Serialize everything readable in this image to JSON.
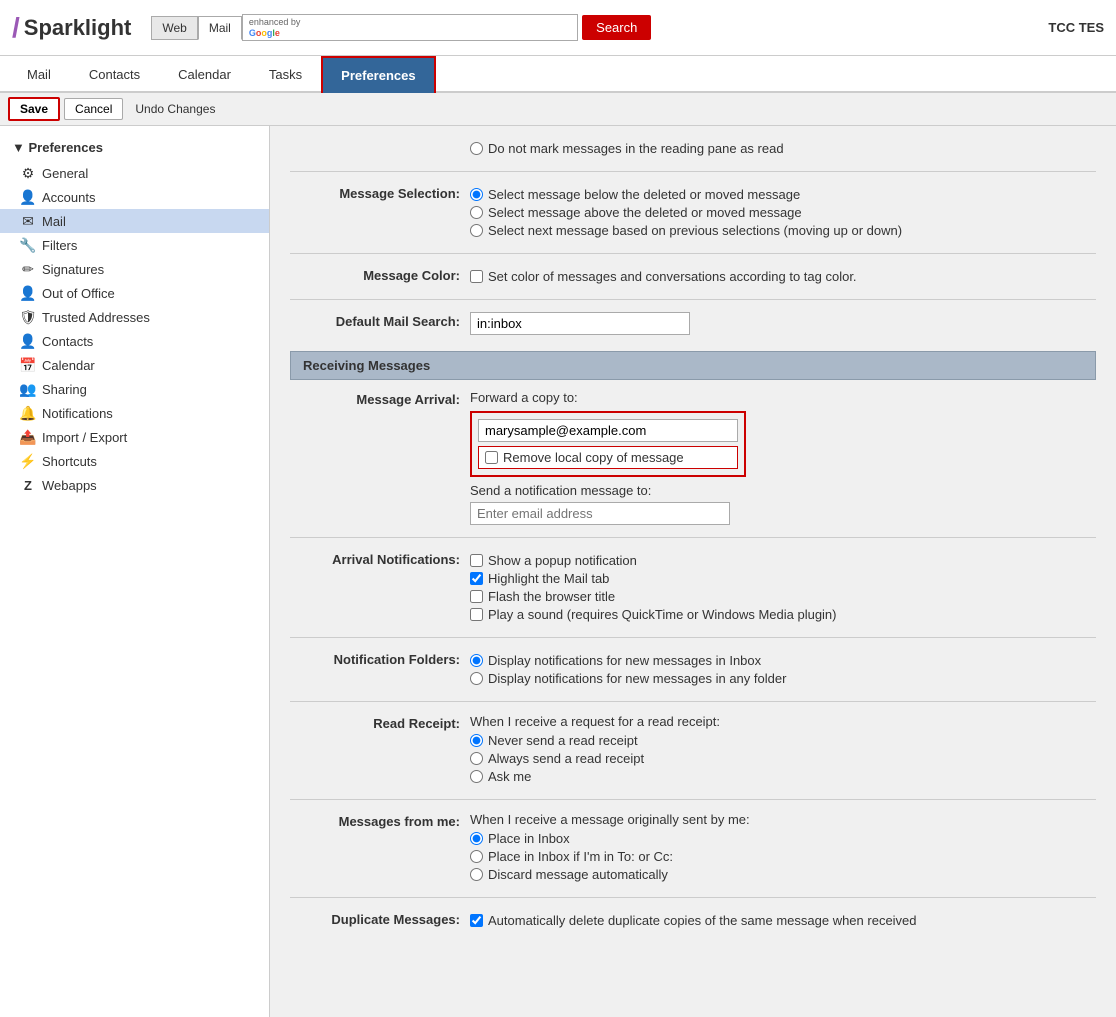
{
  "header": {
    "logo_slash": "/",
    "logo_text": "Sparklight",
    "search_tab_web": "Web",
    "search_tab_mail": "Mail",
    "enhanced_by": "enhanced by",
    "google": "Google",
    "search_button": "Search",
    "user": "TCC TES"
  },
  "nav": {
    "tabs": [
      "Mail",
      "Contacts",
      "Calendar",
      "Tasks",
      "Preferences"
    ]
  },
  "toolbar": {
    "save": "Save",
    "cancel": "Cancel",
    "undo": "Undo Changes"
  },
  "sidebar": {
    "title": "Preferences",
    "items": [
      {
        "label": "General",
        "icon": "⚙"
      },
      {
        "label": "Accounts",
        "icon": "👤"
      },
      {
        "label": "Mail",
        "icon": "✉",
        "active": true
      },
      {
        "label": "Filters",
        "icon": "🔧"
      },
      {
        "label": "Signatures",
        "icon": "✏"
      },
      {
        "label": "Out of Office",
        "icon": "👤"
      },
      {
        "label": "Trusted Addresses",
        "icon": "🛡"
      },
      {
        "label": "Contacts",
        "icon": "👤"
      },
      {
        "label": "Calendar",
        "icon": "📅"
      },
      {
        "label": "Sharing",
        "icon": "👥"
      },
      {
        "label": "Notifications",
        "icon": "🔔"
      },
      {
        "label": "Import / Export",
        "icon": "📤"
      },
      {
        "label": "Shortcuts",
        "icon": "⚡"
      },
      {
        "label": "Webapps",
        "icon": "Z"
      }
    ]
  },
  "content": {
    "reading_pane": {
      "option1": "Do not mark messages in the reading pane as read"
    },
    "message_selection": {
      "label": "Message Selection:",
      "option1": "Select message below the deleted or moved message",
      "option2": "Select message above the deleted or moved message",
      "option3": "Select next message based on previous selections (moving up or down)"
    },
    "message_color": {
      "label": "Message Color:",
      "option1": "Set color of messages and conversations according to tag color."
    },
    "default_mail_search": {
      "label": "Default Mail Search:",
      "value": "in:inbox"
    },
    "receiving_messages": {
      "section_title": "Receiving Messages"
    },
    "message_arrival": {
      "label": "Message Arrival:",
      "forward_label": "Forward a copy to:",
      "forward_email": "marysample@example.com",
      "remove_local_label": "Remove local copy of message",
      "notification_label": "Send a notification message to:",
      "notification_placeholder": "Enter email address"
    },
    "arrival_notifications": {
      "label": "Arrival Notifications:",
      "option1": "Show a popup notification",
      "option2": "Highlight the Mail tab",
      "option3": "Flash the browser title",
      "option4": "Play a sound (requires QuickTime or Windows Media plugin)"
    },
    "notification_folders": {
      "label": "Notification Folders:",
      "option1": "Display notifications for new messages in Inbox",
      "option2": "Display notifications for new messages in any folder"
    },
    "read_receipt": {
      "label": "Read Receipt:",
      "intro": "When I receive a request for a read receipt:",
      "option1": "Never send a read receipt",
      "option2": "Always send a read receipt",
      "option3": "Ask me"
    },
    "messages_from_me": {
      "label": "Messages from me:",
      "intro": "When I receive a message originally sent by me:",
      "option1": "Place in Inbox",
      "option2": "Place in Inbox if I'm in To: or Cc:",
      "option3": "Discard message automatically"
    },
    "duplicate_messages": {
      "label": "Duplicate Messages:",
      "option1": "Automatically delete duplicate copies of the same message when received"
    }
  }
}
